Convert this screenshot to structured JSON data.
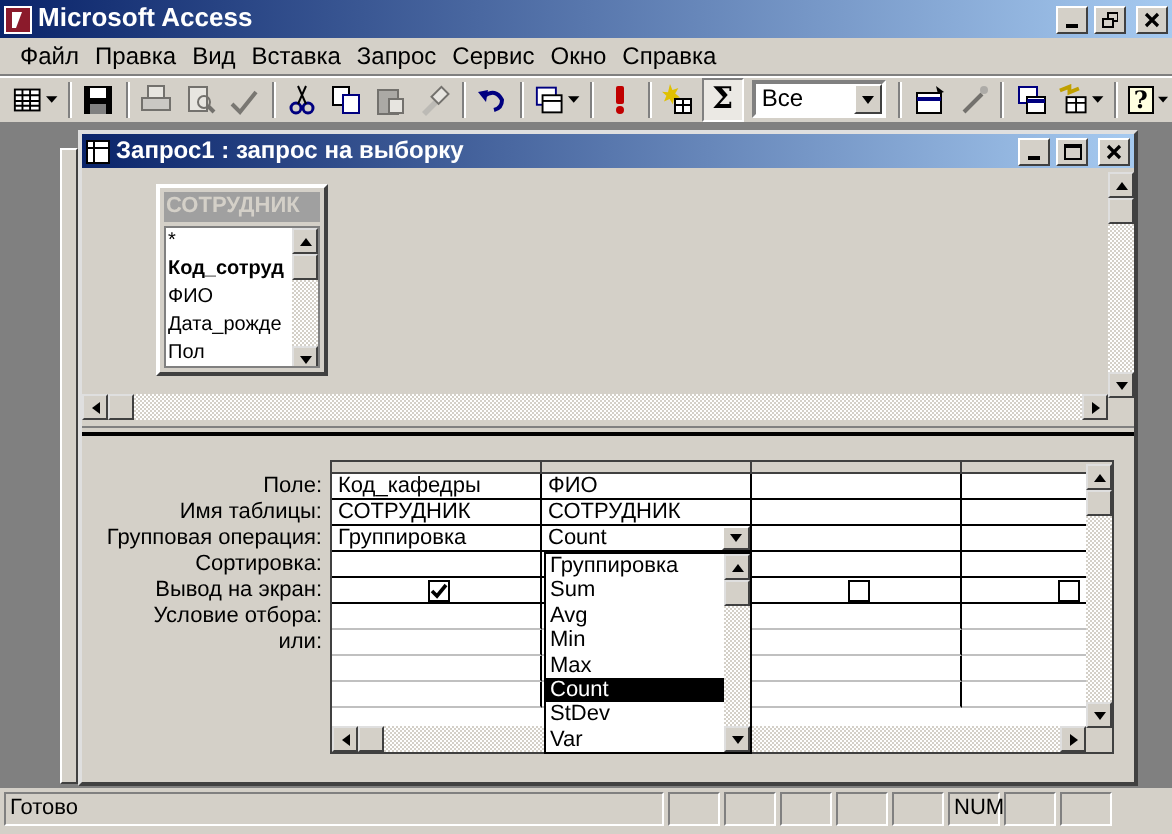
{
  "window": {
    "title": "Microsoft Access"
  },
  "menu": [
    "Файл",
    "Правка",
    "Вид",
    "Вставка",
    "Запрос",
    "Сервис",
    "Окно",
    "Справка"
  ],
  "toolbar": [
    {
      "kind": "table-view",
      "dropdown": true,
      "disabled": false
    },
    {
      "kind": "separator"
    },
    {
      "kind": "save",
      "disabled": false
    },
    {
      "kind": "separator"
    },
    {
      "kind": "print",
      "disabled": true
    },
    {
      "kind": "preview",
      "disabled": true
    },
    {
      "kind": "spelling",
      "disabled": true
    },
    {
      "kind": "separator"
    },
    {
      "kind": "cut",
      "disabled": false
    },
    {
      "kind": "copy",
      "disabled": false
    },
    {
      "kind": "paste",
      "disabled": true
    },
    {
      "kind": "brush",
      "disabled": true
    },
    {
      "kind": "separator"
    },
    {
      "kind": "undo",
      "disabled": false
    },
    {
      "kind": "separator"
    },
    {
      "kind": "query-type",
      "dropdown": true,
      "disabled": false
    },
    {
      "kind": "separator"
    },
    {
      "kind": "run",
      "disabled": false
    },
    {
      "kind": "separator"
    },
    {
      "kind": "show-table",
      "disabled": false
    },
    {
      "kind": "totals",
      "glyph": "Σ",
      "pressed": true,
      "disabled": false
    },
    {
      "kind": "combo",
      "value": "Все"
    },
    {
      "kind": "separator"
    },
    {
      "kind": "properties",
      "disabled": false
    },
    {
      "kind": "build",
      "disabled": true
    },
    {
      "kind": "separator"
    },
    {
      "kind": "database-window",
      "disabled": false
    },
    {
      "kind": "new-object",
      "dropdown": true,
      "disabled": false
    },
    {
      "kind": "separator"
    },
    {
      "kind": "help",
      "glyph": "?",
      "dropdown": true,
      "disabled": false
    }
  ],
  "query_window": {
    "title": "Запрос1 : запрос на выборку",
    "table": {
      "title": "СОТРУДНИК",
      "fields": [
        {
          "name": "*",
          "bold": false
        },
        {
          "name": "Код_сотруд",
          "bold": true
        },
        {
          "name": "ФИО",
          "bold": false
        },
        {
          "name": "Дата_рожде",
          "bold": false
        },
        {
          "name": "Пол",
          "bold": false
        }
      ]
    },
    "grid": {
      "row_labels": [
        "Поле:",
        "Имя таблицы:",
        "Групповая операция:",
        "Сортировка:",
        "Вывод на экран:",
        "Условие отбора:",
        "или:"
      ],
      "columns": [
        {
          "field": "Код_кафедры",
          "table": "СОТРУДНИК",
          "total": "Группировка",
          "show": true
        },
        {
          "field": "ФИО",
          "table": "СОТРУДНИК",
          "total": "Count",
          "dropdown_open": true
        },
        {
          "show": false
        },
        {
          "show": false
        }
      ],
      "total_dropdown": [
        {
          "label": "Группировка",
          "selected": false
        },
        {
          "label": "Sum",
          "selected": false
        },
        {
          "label": "Avg",
          "selected": false
        },
        {
          "label": "Min",
          "selected": false
        },
        {
          "label": "Max",
          "selected": false
        },
        {
          "label": "Count",
          "selected": true
        },
        {
          "label": "StDev",
          "selected": false
        },
        {
          "label": "Var",
          "selected": false
        }
      ]
    }
  },
  "status_bar": {
    "text": "Готово",
    "indicators": [
      "NUM"
    ]
  }
}
